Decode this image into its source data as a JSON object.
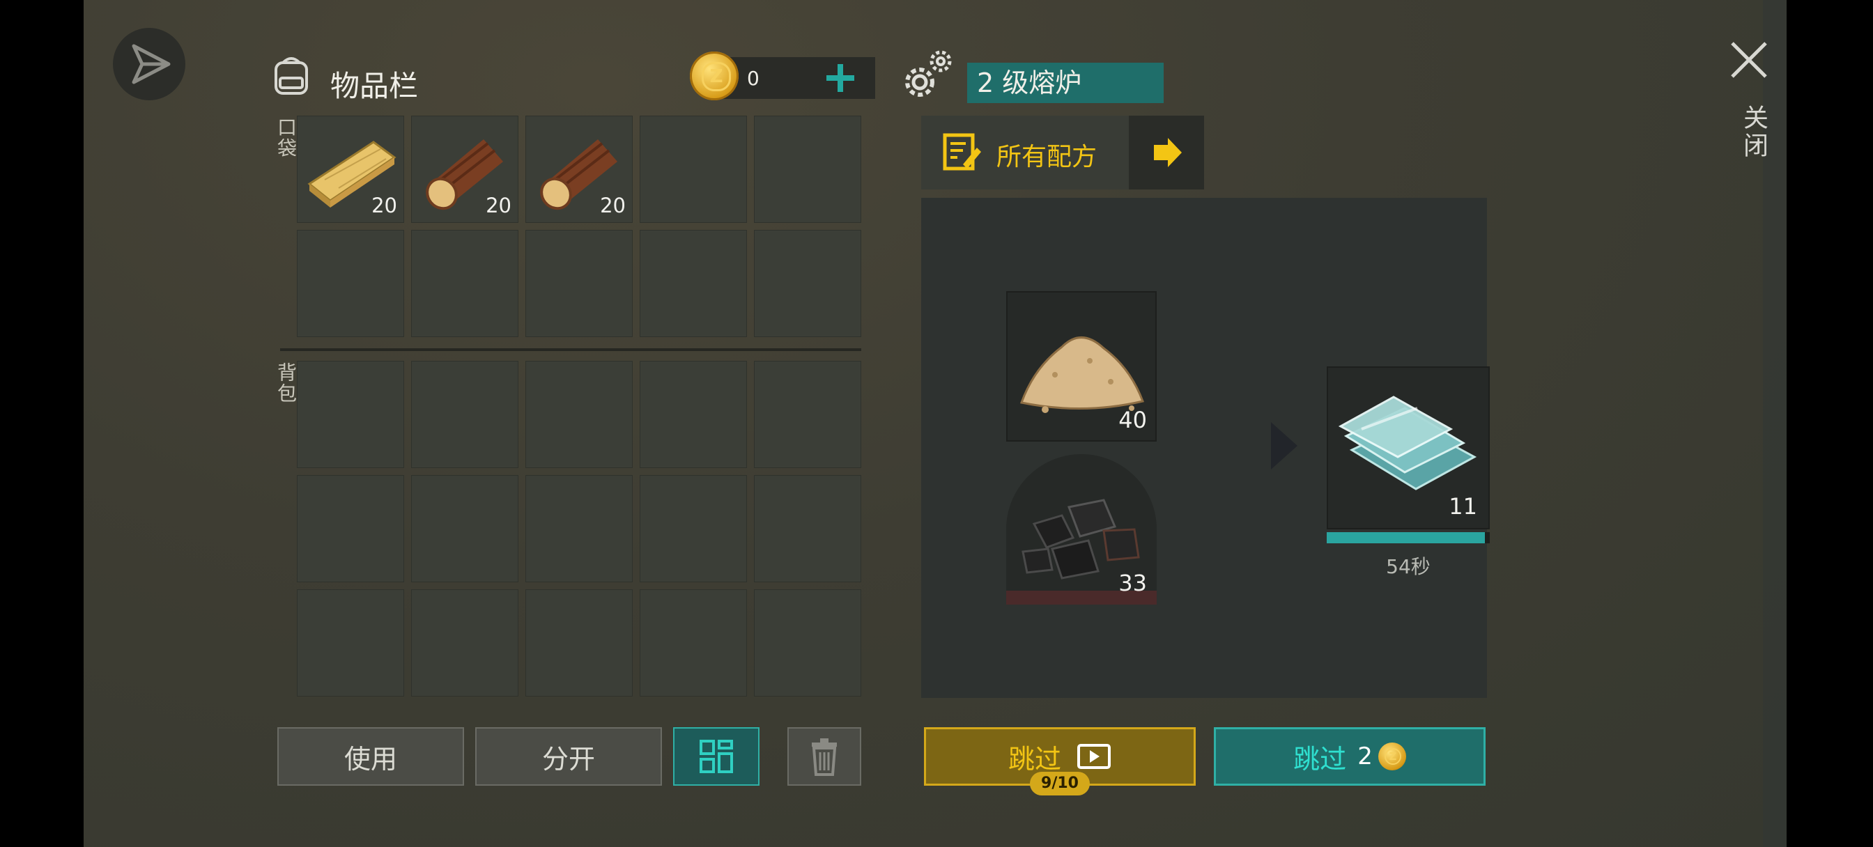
{
  "inventory": {
    "title": "物品栏",
    "pocket_label": "口袋",
    "backpack_label": "背包",
    "coins": "0",
    "pocket_slots": [
      {
        "item": "wood-plank",
        "count": "20"
      },
      {
        "item": "log",
        "count": "20"
      },
      {
        "item": "log",
        "count": "20"
      }
    ]
  },
  "furnace": {
    "title": "2 级熔炉",
    "recipes_label": "所有配方",
    "input_sand_count": "40",
    "input_coal_count": "33",
    "output_count": "11",
    "timer": "54秒",
    "progress": 0.97
  },
  "actions": {
    "use_label": "使用",
    "split_label": "分开",
    "skip_ad_label": "跳过",
    "skip_ad_counter": "9/10",
    "skip_coin_label": "跳过",
    "skip_coin_cost": "2"
  },
  "close_label": "关闭",
  "colors": {
    "teal": "#1f6e6a",
    "gold": "#7d6614",
    "accent_yellow": "#f3c514"
  }
}
